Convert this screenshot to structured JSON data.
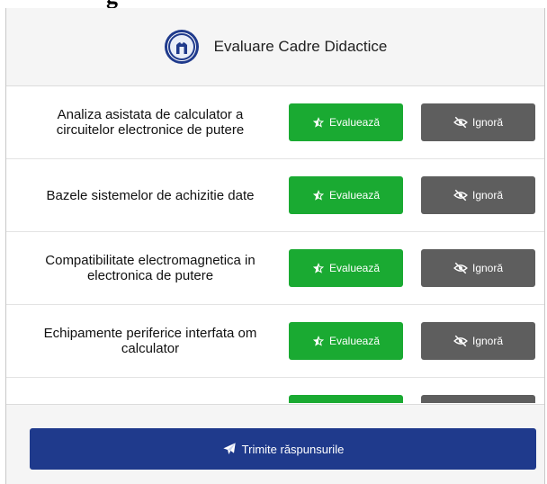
{
  "background": {
    "top_title_fragment": "g"
  },
  "modal": {
    "title": "Evaluare Cadre Didactice",
    "logo_icon": "university-seal"
  },
  "actions": {
    "evaluate_label": "Evaluează",
    "evaluate_icon": "star-half-icon",
    "ignore_label": "Ignoră",
    "ignore_icon": "eye-slash-icon"
  },
  "courses": [
    {
      "name": "Analiza asistata de calculator a circuitelor electronice de putere"
    },
    {
      "name": "Bazele sistemelor de achizitie date"
    },
    {
      "name": "Compatibilitate electromagnetica in electronica de putere"
    },
    {
      "name": "Echipamente periferice interfata om calculator"
    },
    {
      "name": ""
    }
  ],
  "footer": {
    "submit_label": "Trimite răspunsurile",
    "submit_icon": "paper-plane-icon"
  },
  "colors": {
    "evaluate": "#1aaa32",
    "ignore": "#5e5e5e",
    "submit": "#1f3a8c"
  }
}
